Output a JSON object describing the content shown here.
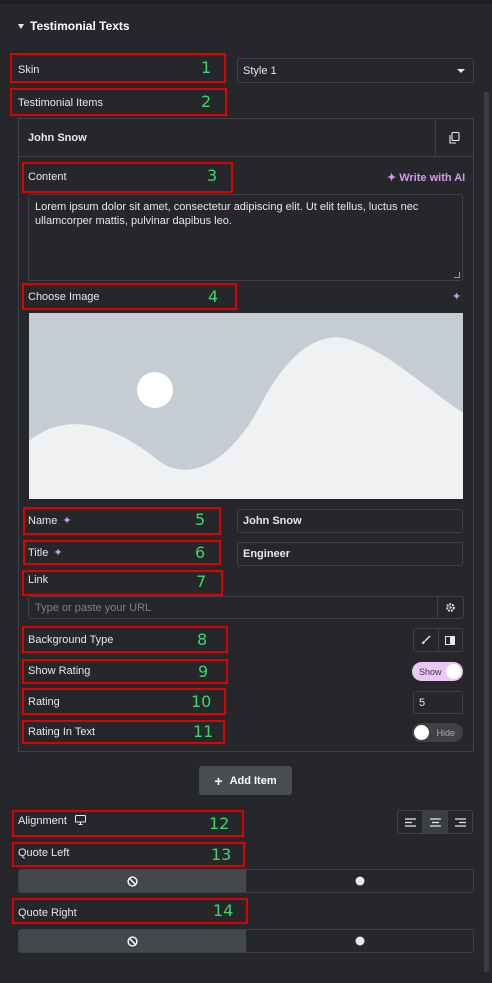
{
  "section": {
    "title": "Testimonial Texts"
  },
  "skin": {
    "label": "Skin",
    "value": "Style 1"
  },
  "testimonial_items": {
    "label": "Testimonial Items"
  },
  "item": {
    "title": "John Snow",
    "content_label": "Content",
    "write_ai": "Write with AI",
    "content_value": "Lorem ipsum dolor sit amet, consectetur adipiscing elit. Ut elit tellus, luctus nec ullamcorper mattis, pulvinar dapibus leo.",
    "choose_image_label": "Choose Image",
    "name_label": "Name",
    "name_value": "John Snow",
    "title_label": "Title",
    "title_value": "Engineer",
    "link_label": "Link",
    "link_placeholder": "Type or paste your URL",
    "bg_type_label": "Background Type",
    "show_rating_label": "Show Rating",
    "show_rating_state": "Show",
    "rating_label": "Rating",
    "rating_value": "5",
    "rating_in_text_label": "Rating In Text",
    "rating_in_text_state": "Hide"
  },
  "add_item": {
    "label": "Add Item"
  },
  "alignment": {
    "label": "Alignment"
  },
  "quote_left": {
    "label": "Quote Left"
  },
  "quote_right": {
    "label": "Quote Right"
  },
  "annotations": [
    "1",
    "2",
    "3",
    "4",
    "5",
    "6",
    "7",
    "8",
    "9",
    "10",
    "11",
    "12",
    "13",
    "14"
  ],
  "colors": {
    "panel": "#26272b",
    "annotation_box": "#e10000",
    "annotation_number": "#3fd66b",
    "ai_accent": "#d59ae9"
  },
  "icons": [
    "caret-down-icon",
    "duplicate-icon",
    "sparkle-icon",
    "gear-icon",
    "brush-icon",
    "gradient-icon",
    "desktop-icon",
    "align-left-icon",
    "align-center-icon",
    "align-right-icon",
    "none-icon",
    "dot-icon",
    "plus-icon"
  ]
}
